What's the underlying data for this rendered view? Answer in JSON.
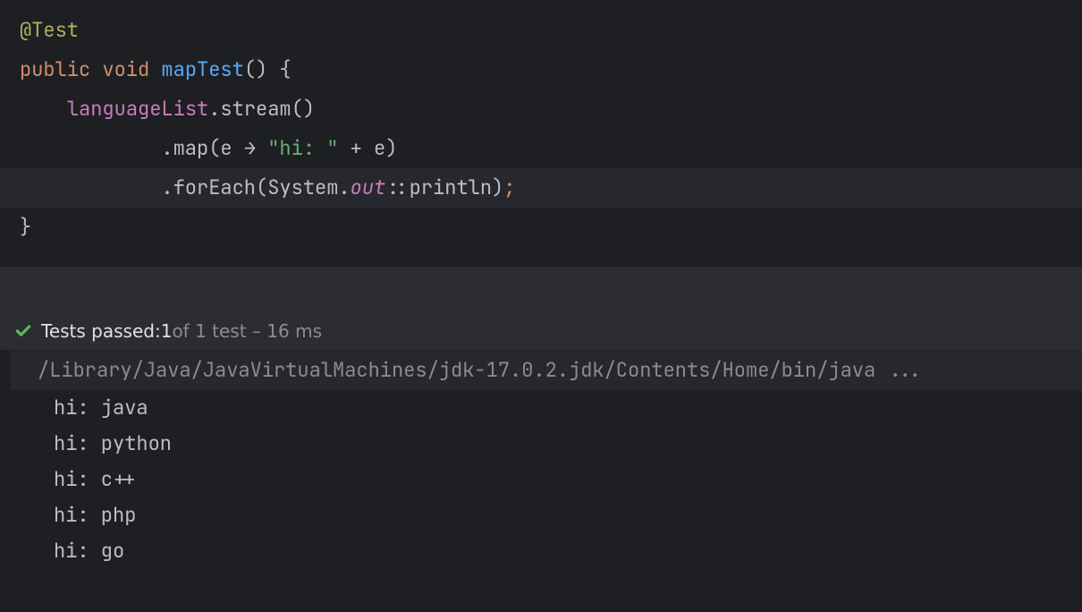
{
  "code": {
    "l1": {
      "annotation": "@Test"
    },
    "l2": {
      "kw1": "public",
      "kw2": "void",
      "name": "mapTest",
      "parens": "()",
      "brace": " {"
    },
    "l3": {
      "indent": "    ",
      "field": "languageList",
      "dot": ".",
      "call": "stream",
      "parens": "()"
    },
    "l4": {
      "indent": "            ",
      "dot": ".",
      "call": "map",
      "open": "(",
      "param": "e",
      "arrow": " → ",
      "str": "\"hi: \"",
      "plus": " + ",
      "param2": "e",
      "close": ")"
    },
    "l5": {
      "indent": "            ",
      "dot": ".",
      "call": "forEach",
      "open": "(",
      "cls": "System",
      "dot2": ".",
      "out": "out",
      "ref": "::",
      "m": "println",
      "close": ")",
      "semi": ";"
    },
    "l6": {
      "brace": "}"
    }
  },
  "tests": {
    "label": "Tests passed: ",
    "count": "1",
    "rest": " of 1 test – 16 ms"
  },
  "console": {
    "cmd": "/Library/Java/JavaVirtualMachines/jdk-17.0.2.jdk/Contents/Home/bin/java ...",
    "lines": [
      "hi: java",
      "hi: python",
      "hi: c++",
      "hi: php",
      "hi: go"
    ]
  }
}
